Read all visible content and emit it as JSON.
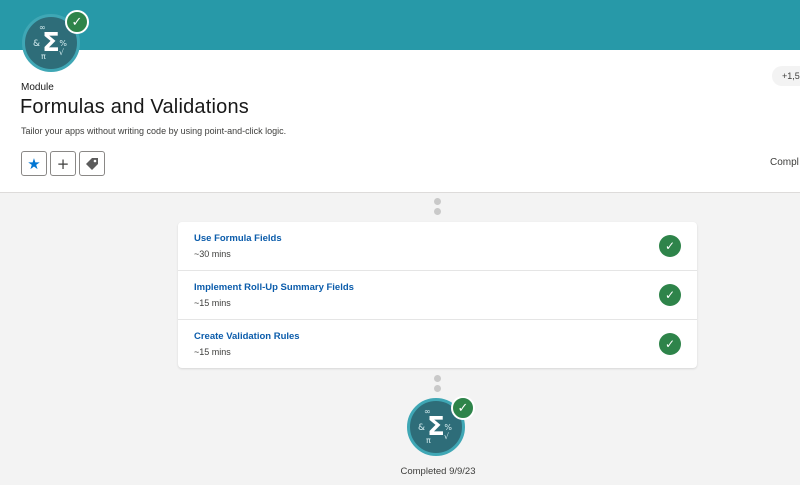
{
  "module": {
    "kicker": "Module",
    "title": "Formulas and Validations",
    "description": "Tailor your apps without writing code by using point-and-click logic.",
    "points": "+1,5",
    "status_text": "Compl",
    "badge_icon": "sigma-math-badge-icon",
    "check_icon": "check-icon"
  },
  "actions": [
    {
      "name": "favorite",
      "icon": "star-icon",
      "glyph": "★"
    },
    {
      "name": "add-to-list",
      "icon": "plus-icon",
      "glyph": "+"
    },
    {
      "name": "tag",
      "icon": "tag-icon",
      "glyph": "🏷"
    }
  ],
  "units": [
    {
      "title": "Use Formula Fields",
      "time": "~30 mins",
      "completed": true
    },
    {
      "title": "Implement Roll-Up Summary Fields",
      "time": "~15 mins",
      "completed": true
    },
    {
      "title": "Create Validation Rules",
      "time": "~15 mins",
      "completed": true
    }
  ],
  "completion": {
    "text": "Completed 9/9/23"
  },
  "colors": {
    "banner": "#2799a8",
    "badge": "#2e6d79",
    "success": "#2e844a",
    "link": "#0b5cab",
    "brand": "#0176d3"
  }
}
